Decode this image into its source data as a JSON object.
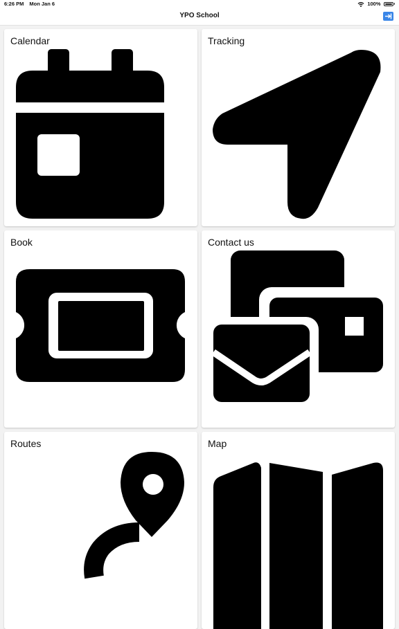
{
  "status_bar": {
    "time": "6:26 PM",
    "date": "Mon Jan 6",
    "battery": "100%",
    "wifi_icon": "wifi-icon",
    "battery_icon": "battery-icon"
  },
  "nav": {
    "title": "YPO School",
    "logout_icon": "logout-icon",
    "accent_color": "#3a86e8"
  },
  "tiles": [
    {
      "label": "Calendar",
      "icon": "calendar-icon"
    },
    {
      "label": "Tracking",
      "icon": "navigation-arrow-icon"
    },
    {
      "label": "Book",
      "icon": "ticket-icon"
    },
    {
      "label": "Contact us",
      "icon": "mail-contact-icon"
    },
    {
      "label": "Routes",
      "icon": "route-pin-icon"
    },
    {
      "label": "Map",
      "icon": "map-icon"
    }
  ]
}
